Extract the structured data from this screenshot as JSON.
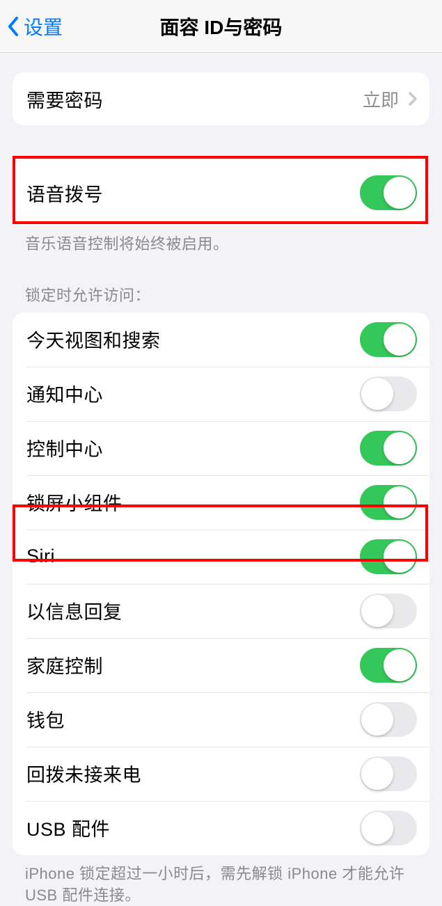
{
  "header": {
    "back_label": "设置",
    "title": "面容 ID与密码"
  },
  "passcode": {
    "require_label": "需要密码",
    "require_value": "立即"
  },
  "voice_dial": {
    "label": "语音拨号",
    "on": true,
    "footer": "音乐语音控制将始终被启用。"
  },
  "lock_access": {
    "header": "锁定时允许访问：",
    "items": [
      {
        "label": "今天视图和搜索",
        "on": true
      },
      {
        "label": "通知中心",
        "on": false
      },
      {
        "label": "控制中心",
        "on": true
      },
      {
        "label": "锁屏小组件",
        "on": true
      },
      {
        "label": "Siri",
        "on": true
      },
      {
        "label": "以信息回复",
        "on": false
      },
      {
        "label": "家庭控制",
        "on": true
      },
      {
        "label": "钱包",
        "on": false
      },
      {
        "label": "回拨未接来电",
        "on": false
      },
      {
        "label": "USB 配件",
        "on": false
      }
    ],
    "footer": "iPhone 锁定超过一小时后，需先解锁 iPhone 才能允许 USB 配件连接。"
  }
}
